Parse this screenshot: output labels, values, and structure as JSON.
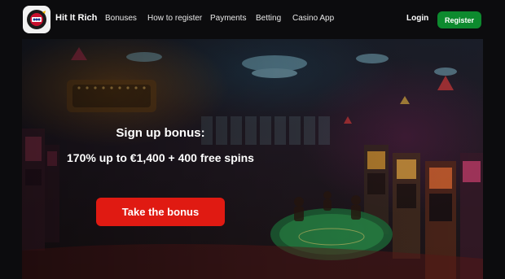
{
  "header": {
    "brand": "Hit It Rich",
    "logo_icon": "slot-machine-logo-icon",
    "nav": [
      "Bonuses",
      "How to register",
      "Payments",
      "Betting",
      "Casino App"
    ],
    "login_label": "Login",
    "register_label": "Register"
  },
  "hero": {
    "title": "Sign up bonus:",
    "offer": "170% up to €1,400 + 400 free spins",
    "cta_label": "Take the bonus",
    "background": "casino-floor-illustration"
  },
  "colors": {
    "register_button": "#0d8a2e",
    "cta_button": "#e01a12",
    "page_background": "#0c0c0e"
  }
}
